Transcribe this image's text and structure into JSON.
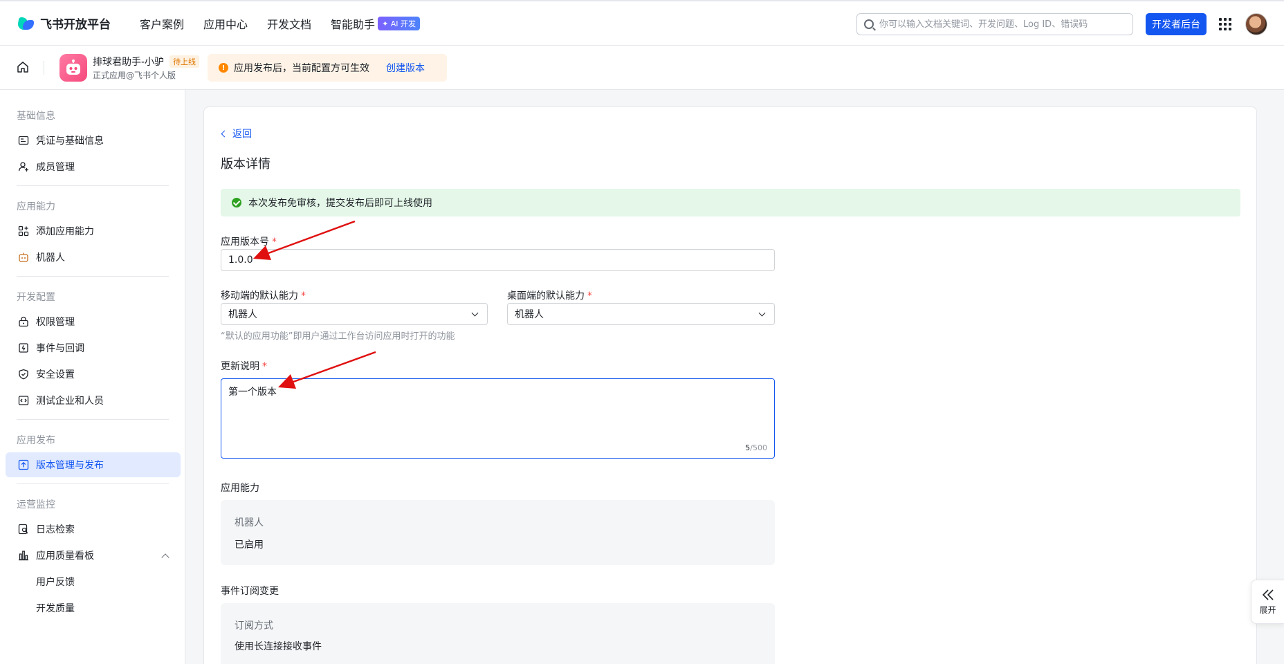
{
  "topnav": {
    "logo_text": "飞书开放平台",
    "links": [
      "客户案例",
      "应用中心",
      "开发文档",
      "智能助手"
    ],
    "ai_badge": "✦ AI 开发",
    "search_placeholder": "你可以输入文档关键词、开发问题、Log ID、错误码",
    "dev_console": "开发者后台"
  },
  "appbar": {
    "app_name": "排球君助手-小驴",
    "status": "待上线",
    "app_sub": "正式应用@飞书个人版",
    "notice": "应用发布后，当前配置方可生效",
    "notice_link": "创建版本"
  },
  "sidebar": {
    "groups": [
      "基础信息",
      "应用能力",
      "开发配置",
      "应用发布",
      "运营监控"
    ],
    "items": [
      "凭证与基础信息",
      "成员管理",
      "添加应用能力",
      "机器人",
      "权限管理",
      "事件与回调",
      "安全设置",
      "测试企业和人员",
      "版本管理与发布",
      "日志检索",
      "应用质量看板"
    ],
    "subitems": [
      "用户反馈",
      "开发质量"
    ]
  },
  "main": {
    "back": "返回",
    "title": "版本详情",
    "success_msg": "本次发布免审核，提交发布后即可上线使用",
    "version_label": "应用版本号",
    "version_value": "1.0.0",
    "mobile_label": "移动端的默认能力",
    "mobile_value": "机器人",
    "desktop_label": "桌面端的默认能力",
    "desktop_value": "机器人",
    "default_hint": "“默认的应用功能”即用户通过工作台访问应用时打开的功能",
    "notes_label": "更新说明",
    "notes_value": "第一个版本",
    "notes_count": "5",
    "notes_max": "/500",
    "capability_label": "应用能力",
    "capability_key": "机器人",
    "capability_value": "已启用",
    "event_label": "事件订阅变更",
    "event_key": "订阅方式",
    "event_value": "使用长连接接收事件",
    "required_mark": "*"
  },
  "expand_label": "展开",
  "colors": {
    "primary": "#1456f0",
    "success_bg": "#e4f7e8",
    "warn": "#ff8800",
    "arrow": "#e01010"
  }
}
